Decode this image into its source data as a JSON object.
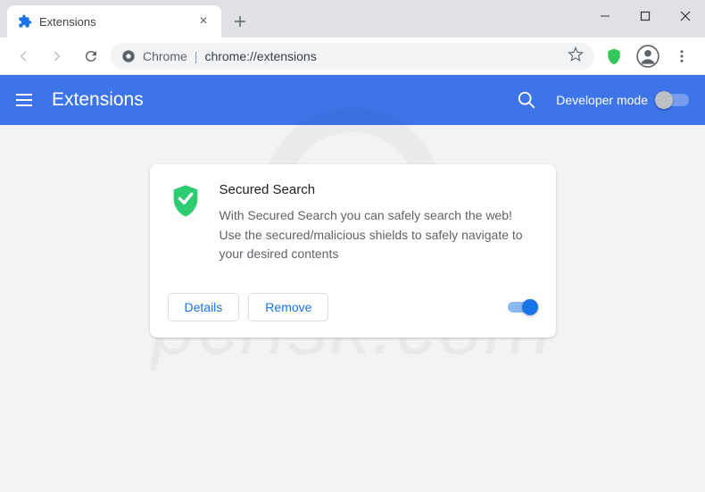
{
  "window": {
    "tab_title": "Extensions"
  },
  "address": {
    "prefix": "Chrome",
    "url": "chrome://extensions"
  },
  "header": {
    "title": "Extensions",
    "developer_mode": "Developer mode"
  },
  "card": {
    "name": "Secured Search",
    "description": "With Secured Search you can safely search the web! Use the secured/malicious shields to safely navigate to your desired contents",
    "details_label": "Details",
    "remove_label": "Remove"
  },
  "watermark": "pcrisk.com"
}
